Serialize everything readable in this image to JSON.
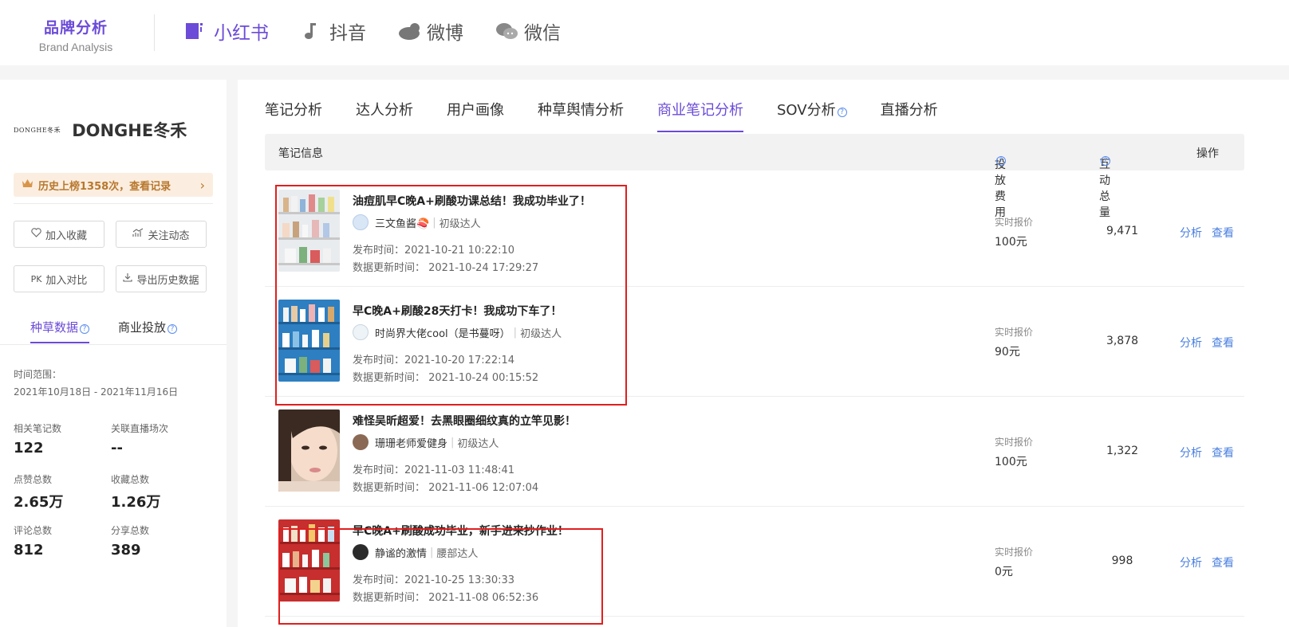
{
  "header": {
    "brand_cn": "品牌分析",
    "brand_en": "Brand Analysis",
    "platforms": [
      {
        "label": "小红书",
        "icon": "xiaohongshu-icon",
        "active": true
      },
      {
        "label": "抖音",
        "icon": "douyin-icon",
        "active": false
      },
      {
        "label": "微博",
        "icon": "weibo-icon",
        "active": false
      },
      {
        "label": "微信",
        "icon": "wechat-icon",
        "active": false
      }
    ]
  },
  "sidebar": {
    "brand_logo_text": "DONGHE冬禾",
    "brand_name": "DONGHE冬禾",
    "history": "历史上榜1358次，查看记录",
    "buttons": {
      "favorite": "加入收藏",
      "follow": "关注动态",
      "compare_prefix": "PK",
      "compare": "加入对比",
      "export": "导出历史数据"
    },
    "tabs": [
      "种草数据",
      "商业投放"
    ],
    "range_label": "时间范围：",
    "range_value": "2021年10月18日 - 2021年11月16日",
    "stats": [
      {
        "label": "相关笔记数",
        "value": "122"
      },
      {
        "label": "关联直播场次",
        "value": "--"
      },
      {
        "label": "点赞总数",
        "value": "2.65万"
      },
      {
        "label": "收藏总数",
        "value": "1.26万"
      },
      {
        "label": "评论总数",
        "value": "812"
      },
      {
        "label": "分享总数",
        "value": "389"
      }
    ]
  },
  "main": {
    "tabs": [
      "笔记分析",
      "达人分析",
      "用户画像",
      "种草舆情分析",
      "商业笔记分析",
      "SOV分析",
      "直播分析"
    ],
    "active_tab": "商业笔记分析",
    "table_headers": {
      "info": "笔记信息",
      "cost": "投放费用",
      "interaction": "互动总量",
      "ops": "操作"
    },
    "rows": [
      {
        "title": "油痘肌早C晚A+刷酸功课总结！我成功毕业了！",
        "author": "三文鱼酱🍣",
        "level": "初级达人",
        "publish": "发布时间：2021-10-21 10:22:10",
        "update": "数据更新时间： 2021-10-24 17:29:27",
        "price_label": "实时报价",
        "price": "100元",
        "interaction": "9,471",
        "op_analyze": "分析",
        "op_view": "查看"
      },
      {
        "title": "早C晚A+刷酸28天打卡！我成功下车了！",
        "author": "时尚界大佬cool（是书蔓呀）",
        "level": "初级达人",
        "publish": "发布时间：2021-10-20 17:22:14",
        "update": "数据更新时间： 2021-10-24 00:15:52",
        "price_label": "实时报价",
        "price": "90元",
        "interaction": "3,878",
        "op_analyze": "分析",
        "op_view": "查看"
      },
      {
        "title": "难怪吴昕超爱！去黑眼圈细纹真的立竿见影！",
        "author": "珊珊老师爱健身",
        "level": "初级达人",
        "publish": "发布时间：2021-11-03 11:48:41",
        "update": "数据更新时间： 2021-11-06 12:07:04",
        "price_label": "实时报价",
        "price": "100元",
        "interaction": "1,322",
        "op_analyze": "分析",
        "op_view": "查看"
      },
      {
        "title": "早C晚A+刷酸成功毕业，新手进来抄作业！",
        "author": "静谧的激情",
        "level": "腰部达人",
        "publish": "发布时间：2021-10-25 13:30:33",
        "update": "数据更新时间： 2021-11-08 06:52:36",
        "price_label": "实时报价",
        "price": "0元",
        "interaction": "998",
        "op_analyze": "分析",
        "op_view": "查看"
      }
    ]
  },
  "colors": {
    "accent": "#6b4bd8",
    "link": "#4a7fe0",
    "highlight_box": "#e01f1f",
    "history_bg": "#fbeee0"
  }
}
